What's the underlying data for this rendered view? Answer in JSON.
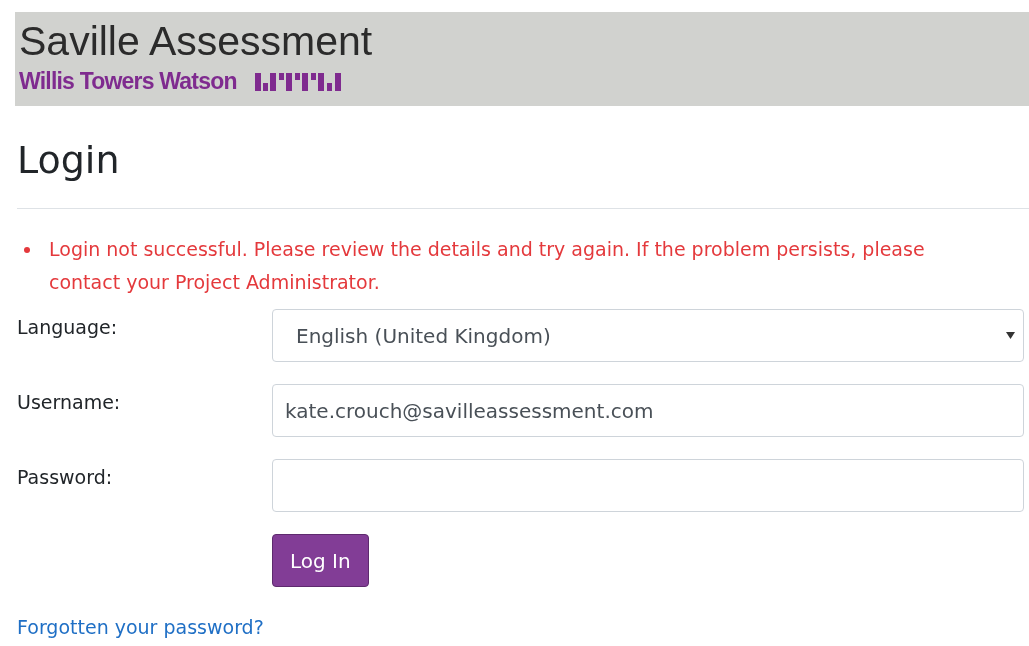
{
  "header": {
    "title": "Saville Assessment",
    "subtitle": "Willis Towers Watson"
  },
  "heading": "Login",
  "errors": [
    "Login not successful. Please review the details and try again. If the problem persists, please contact your Project Administrator."
  ],
  "form": {
    "fields": [
      {
        "kind": "select",
        "label": "Language:",
        "value": "English (United Kingdom)"
      },
      {
        "kind": "text",
        "label": "Username:",
        "value": "kate.crouch@savilleassessment.com"
      },
      {
        "kind": "password",
        "label": "Password:"
      }
    ],
    "submit": "Log In"
  },
  "forgot_link": "Forgotten your password?"
}
